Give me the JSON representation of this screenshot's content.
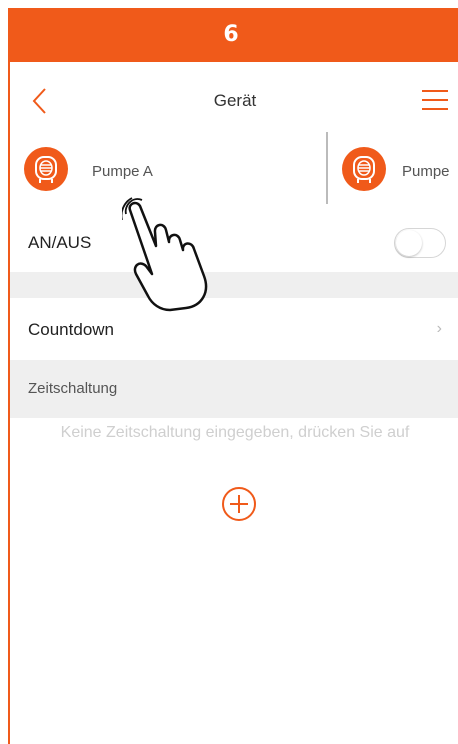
{
  "step": {
    "number": "6"
  },
  "nav": {
    "title": "Gerät"
  },
  "devices": [
    {
      "name": "Pumpe A"
    },
    {
      "name": "Pumpe"
    }
  ],
  "power": {
    "label": "AN/AUS",
    "state": "off"
  },
  "countdown": {
    "label": "Countdown"
  },
  "timer": {
    "section_label": "Zeitschaltung",
    "empty_text": "Keine Zeitschaltung eingegeben, drücken Sie auf"
  },
  "colors": {
    "accent": "#f05a1a",
    "gap": "#efefef"
  },
  "icons": [
    "back-arrow-icon",
    "menu-icon",
    "pump-icon",
    "chevron-right-icon",
    "add-circle-icon",
    "hand-pointer-icon"
  ]
}
